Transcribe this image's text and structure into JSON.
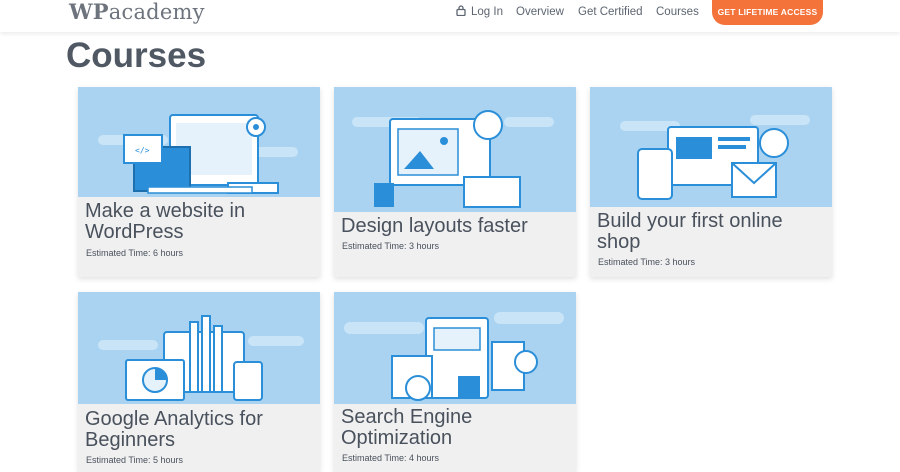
{
  "header": {
    "logo_bold": "WP",
    "logo_rest": "academy",
    "nav": [
      "Log In",
      "Overview",
      "Get Certified",
      "Courses"
    ],
    "cta": "GET LIFETIME ACCESS"
  },
  "page": {
    "title": "Courses"
  },
  "courses": [
    {
      "title_line1": "Make a website in",
      "title_line2": "WordPress",
      "time": "Estimated Time: 6 hours"
    },
    {
      "title_line1": "Design layouts faster",
      "title_line2": "",
      "time": "Estimated Time: 3 hours"
    },
    {
      "title_line1": "Build your first online",
      "title_line2": "shop",
      "time": "Estimated Time: 3 hours"
    },
    {
      "title_line1": "Google Analytics for",
      "title_line2": "Beginners",
      "time": "Estimated Time: 5 hours"
    },
    {
      "title_line1": "Search Engine",
      "title_line2": "Optimization",
      "time": "Estimated Time: 4 hours"
    }
  ],
  "icons": [
    "lock-icon"
  ],
  "colors": {
    "cta": "#f4733a",
    "card_thumb": "#a9d3f1",
    "illustration_blue": "#2b8ed8"
  }
}
